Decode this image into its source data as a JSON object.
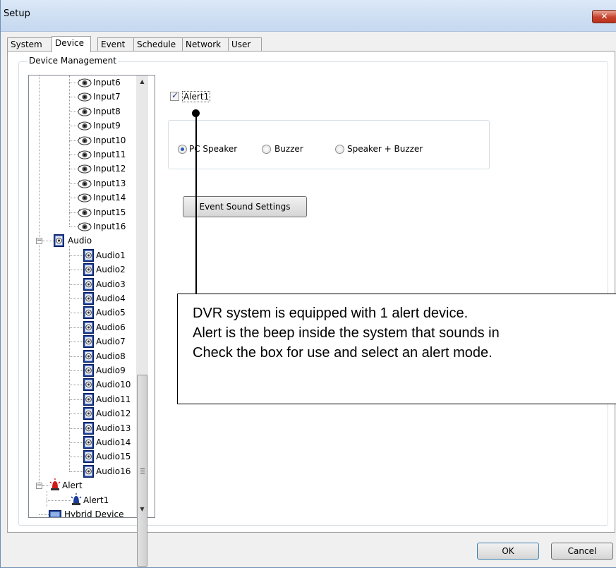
{
  "window": {
    "title": "Setup",
    "close_glyph": "✕"
  },
  "tabs": [
    {
      "label": "System",
      "active": false
    },
    {
      "label": "Device",
      "active": true
    },
    {
      "label": "Event",
      "active": false
    },
    {
      "label": "Schedule",
      "active": false
    },
    {
      "label": "Network",
      "active": false
    },
    {
      "label": "User",
      "active": false
    }
  ],
  "group": {
    "label": "Device Management"
  },
  "tree": {
    "inputs": [
      "Input6",
      "Input7",
      "Input8",
      "Input9",
      "Input10",
      "Input11",
      "Input12",
      "Input13",
      "Input14",
      "Input15",
      "Input16"
    ],
    "audio_label": "Audio",
    "audio_items": [
      "Audio1",
      "Audio2",
      "Audio3",
      "Audio4",
      "Audio5",
      "Audio6",
      "Audio7",
      "Audio8",
      "Audio9",
      "Audio10",
      "Audio11",
      "Audio12",
      "Audio13",
      "Audio14",
      "Audio15",
      "Audio16"
    ],
    "alert_label": "Alert",
    "alert_items": [
      "Alert1"
    ],
    "hybrid_label": "Hybrid Device",
    "collapse_glyph": "−"
  },
  "alert": {
    "checkbox_label": "Alert1",
    "checked": true,
    "modes": [
      {
        "label": "PC Speaker",
        "selected": true
      },
      {
        "label": "Buzzer",
        "selected": false
      },
      {
        "label": "Speaker + Buzzer",
        "selected": false
      }
    ],
    "sound_button": "Event Sound Settings"
  },
  "callout": {
    "lines": [
      "DVR system is equipped with 1 alert device.",
      "Alert is the beep inside the system that sounds in",
      "Check the box for use and select an alert mode."
    ]
  },
  "footer": {
    "ok_label": "OK",
    "cancel_label": "Cancel"
  },
  "colors": {
    "tree_icon_blue": "#1a3c9a",
    "alert_red": "#d01818",
    "callout_border": "#000000"
  }
}
